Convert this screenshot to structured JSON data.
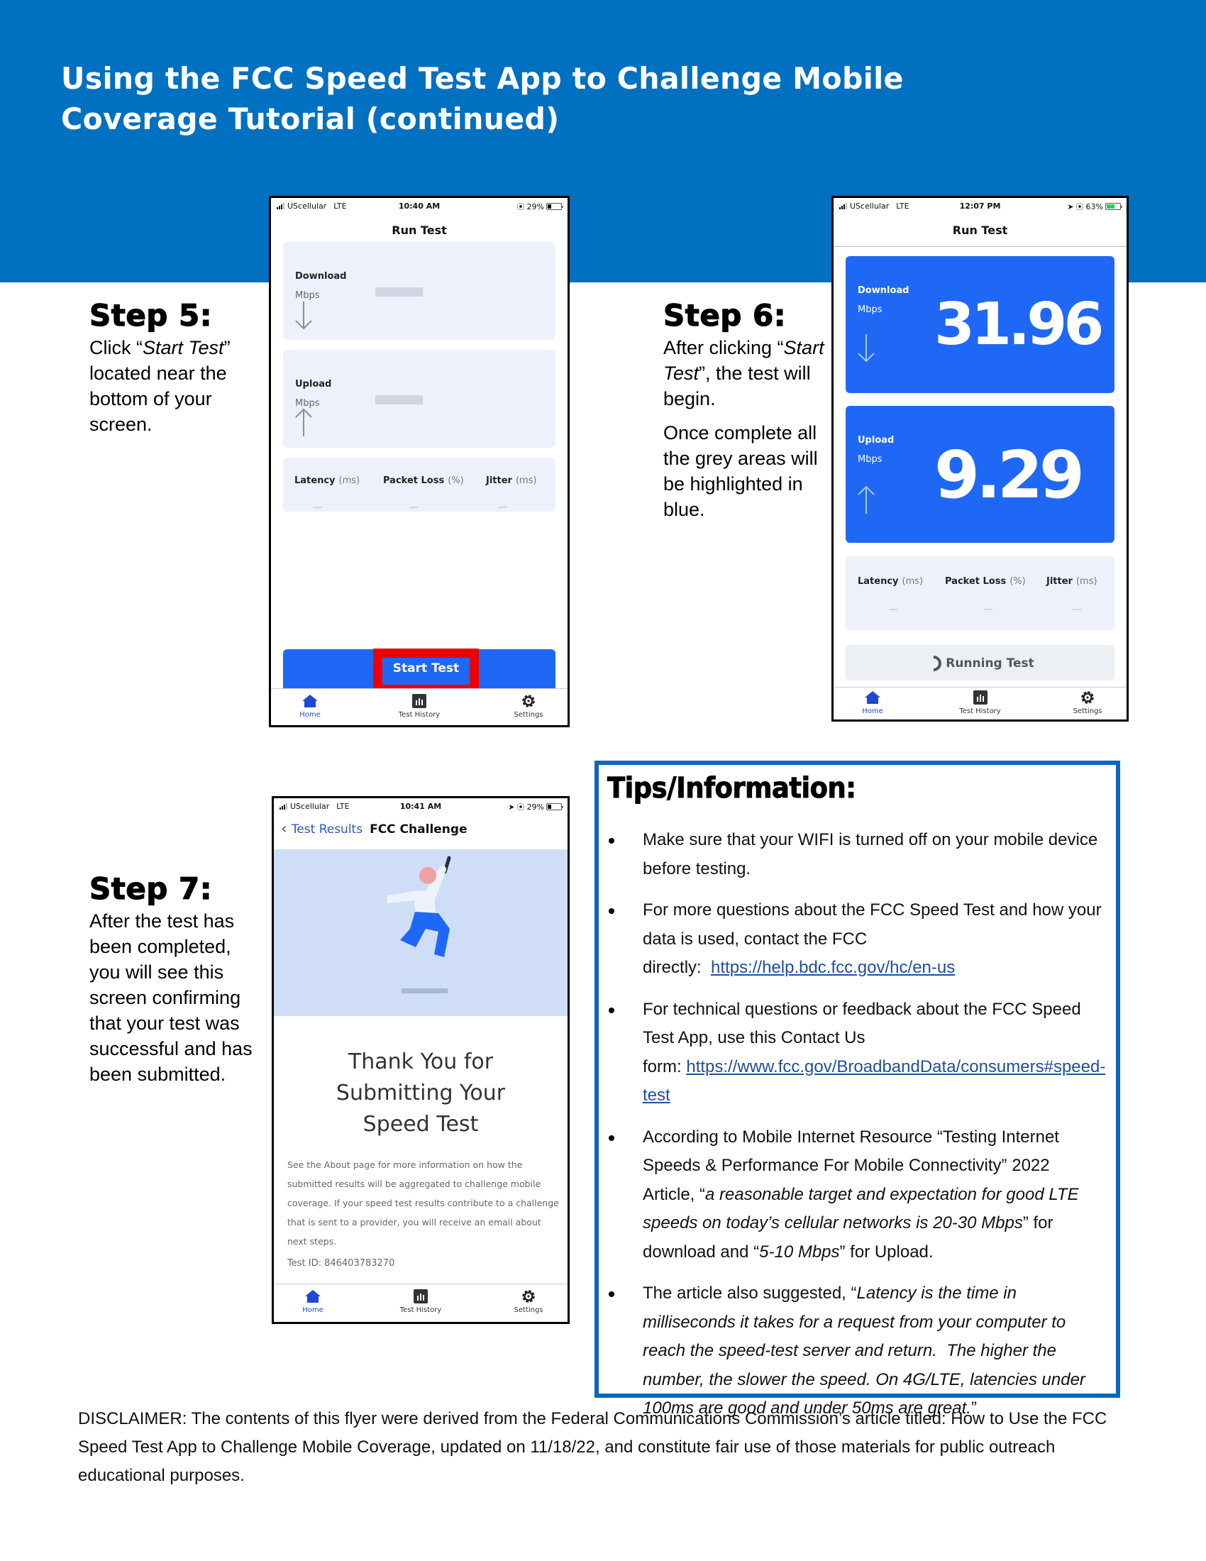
{
  "page": {
    "title_lines": [
      "Using the FCC Speed Test App to Challenge Mobile",
      "Coverage Tutorial (continued)"
    ],
    "colors": {
      "header_blue": "#0070c0",
      "app_blue": "#1f68f5",
      "highlight_red": "#ee0000",
      "tips_border": "#0a67bd"
    }
  },
  "steps": {
    "step5": {
      "heading": "Step 5:",
      "text_before": "Click “",
      "text_em": "Start Test",
      "text_after": "” located near the bottom of your screen."
    },
    "step6": {
      "heading": "Step 6:",
      "p1_before": "After clicking “",
      "p1_em": "Start Test",
      "p1_after": "”, the test will begin.",
      "p2": "Once complete all the grey areas will be highlighted in blue."
    },
    "step7": {
      "heading": "Step 7:",
      "text": "After the test has been completed, you will see this screen confirming that your test was successful and has been submitted."
    }
  },
  "phone1": {
    "status": {
      "carrier": "UScellular",
      "network": "LTE",
      "time": "10:40 AM",
      "battery": "29%",
      "battery_level": 0.29
    },
    "nav_title": "Run Test",
    "download": {
      "label": "Download",
      "unit": "Mbps",
      "icon": "arrow-down-icon"
    },
    "upload": {
      "label": "Upload",
      "unit": "Mbps",
      "icon": "arrow-up-icon"
    },
    "metrics": [
      {
        "label": "Latency",
        "unit": "(ms)",
        "value": "—"
      },
      {
        "label": "Packet Loss",
        "unit": "(%)",
        "value": "—"
      },
      {
        "label": "Jitter",
        "unit": "(ms)",
        "value": "—"
      }
    ],
    "start_button": "Start Test",
    "tabs": [
      {
        "label": "Home",
        "icon": "home-icon",
        "active": true
      },
      {
        "label": "Test History",
        "icon": "bar-chart-icon",
        "active": false
      },
      {
        "label": "Settings",
        "icon": "gear-icon",
        "active": false
      }
    ]
  },
  "phone2": {
    "status": {
      "carrier": "UScellular",
      "network": "LTE",
      "time": "12:07 PM",
      "battery": "63%",
      "battery_level": 0.63
    },
    "nav_title": "Run Test",
    "download": {
      "label": "Download",
      "unit": "Mbps",
      "value": "31.96"
    },
    "upload": {
      "label": "Upload",
      "unit": "Mbps",
      "value": "9.29"
    },
    "metrics": [
      {
        "label": "Latency",
        "unit": "(ms)",
        "value": "—"
      },
      {
        "label": "Packet Loss",
        "unit": "(%)",
        "value": "—"
      },
      {
        "label": "Jitter",
        "unit": "(ms)",
        "value": "—"
      }
    ],
    "running_label": "Running Test",
    "tabs": [
      {
        "label": "Home",
        "icon": "home-icon",
        "active": true
      },
      {
        "label": "Test History",
        "icon": "bar-chart-icon",
        "active": false
      },
      {
        "label": "Settings",
        "icon": "gear-icon",
        "active": false
      }
    ]
  },
  "phone3": {
    "status": {
      "carrier": "UScellular",
      "network": "LTE",
      "time": "10:41 AM",
      "battery": "29%",
      "battery_level": 0.29
    },
    "back_label": "Test Results",
    "screen_title": "FCC Challenge",
    "thanks_lines": [
      "Thank You for",
      "Submitting Your",
      "Speed Test"
    ],
    "body": "See the About page for more information on how the submitted results will be aggregated to challenge mobile coverage. If your speed test results contribute to a challenge that is sent to a provider, you will receive an email about next steps.",
    "test_id": "Test ID: 846403783270",
    "tabs": [
      {
        "label": "Home",
        "icon": "home-icon",
        "active": true
      },
      {
        "label": "Test History",
        "icon": "bar-chart-icon",
        "active": false
      },
      {
        "label": "Settings",
        "icon": "gear-icon",
        "active": false
      }
    ]
  },
  "tips": {
    "heading": "Tips/Information:",
    "items": [
      {
        "text": "Make sure that your WIFI is turned off on your mobile device before testing."
      },
      {
        "text": "For more questions about the FCC Speed Test and how your data is used, contact the FCC directly:  ",
        "link": "https://help.bdc.fcc.gov/hc/en-us"
      },
      {
        "text": "For technical questions or feedback about the FCC Speed Test App, use this Contact Us form: ",
        "link": "https://www.fcc.gov/BroadbandData/consumers#speed-test"
      },
      {
        "text_before": "According to Mobile Internet Resource “Testing Internet Speeds & Performance For Mobile Connectivity” 2022 Article, “",
        "em1": "a reasonable target and expectation for good LTE speeds on today’s cellular networks is 20-30 Mbps",
        "text_mid": "” for download and “",
        "em2": "5-10 Mbps",
        "text_after": "” for Upload."
      },
      {
        "text_before": "The article also suggested, “",
        "em1": "Latency is the time in milliseconds it takes for a request from your computer to reach the speed-test server and return.  The higher the number, the slower the speed. On 4G/LTE, latencies under 100ms are good and under 50ms are great.",
        "text_after": "”"
      }
    ]
  },
  "disclaimer": "DISCLAIMER: The contents of this flyer were derived from the Federal Communications Commission’s article titled: How to Use the FCC Speed Test App to Challenge Mobile Coverage, updated on 11/18/22, and constitute fair use of those materials for public outreach educational purposes."
}
